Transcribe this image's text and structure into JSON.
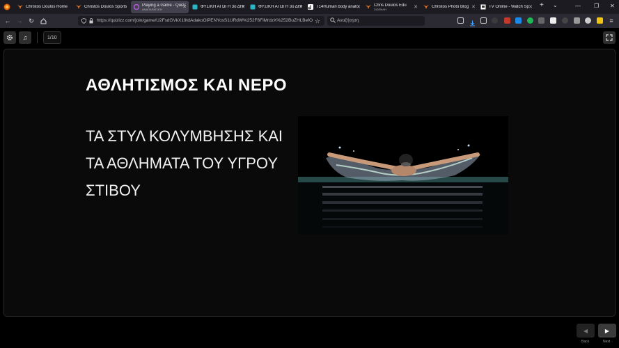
{
  "browser": {
    "tabs": [
      {
        "label": "Christos Doulos Home",
        "sub": "",
        "icon": "fox-icon",
        "active": false
      },
      {
        "label": "Christos Doulos Sports",
        "sub": "",
        "icon": "fox-icon",
        "active": false
      },
      {
        "label": "Playing a Game - Quizizz",
        "sub": "ΑΝΑΠΑΡΑΓΩΓΗ",
        "icon": "quizizz-icon",
        "active": true
      },
      {
        "label": "ΦΥΣΙΚΗ ΑΓΩΓΗ 3ο ΔΗΜ",
        "sub": "",
        "icon": "doc-icon",
        "active": false
      },
      {
        "label": "ΦΥΣΙΚΗ ΑΓΩΓΗ 3ο ΔΗΜ",
        "sub": "",
        "icon": "doc-icon",
        "active": false
      },
      {
        "label": "T14Human body anato",
        "sub": "",
        "icon": "tiktok-icon",
        "active": false
      },
      {
        "label": "Chris Doulos Edu",
        "sub": "ΣΙΩΠΗΛΗ",
        "icon": "fox-icon",
        "active": false
      },
      {
        "label": "Christos Photo Blog",
        "sub": "",
        "icon": "fox-icon",
        "active": false
      },
      {
        "label": "TV Online - Watch Sp",
        "sub": "",
        "icon": "tv-icon",
        "active": false
      }
    ],
    "new_tab": "+",
    "list_tabs": "⌄",
    "minimize": "—",
    "maximize": "❐",
    "close": "✕",
    "url": "https://quizizz.com/join/game/U2FsdGVkX19tdAdakoOiPENYosS1URdW%252F6FiMrdzX%252BuZHLBefO3UK",
    "search_placeholder": "Αναζήτηση",
    "menu": "≡"
  },
  "quiz": {
    "counter": "1/10",
    "settings_icon": "gear-icon",
    "music_icon": "music-note-icon",
    "fullscreen_icon": "expand-icon",
    "title": "ΑΘΛΗΤΙΣΜΟΣ ΚΑΙ ΝΕΡΟ",
    "subtitle": "ΤΑ ΣΤΥΛ ΚΟΛΥΜΒΗΣΗΣ ΚΑΙ ΤΑ ΑΘΛΗΜΑΤΑ ΤΟΥ ΥΓΡΟΥ ΣΤΙΒΟΥ",
    "back_label": "Back",
    "next_label": "Next"
  },
  "colors": {
    "tabbar": "#1c1b22",
    "navbar": "#2b2a33",
    "stage": "#0a0a0a",
    "water": "#2e5a58"
  }
}
